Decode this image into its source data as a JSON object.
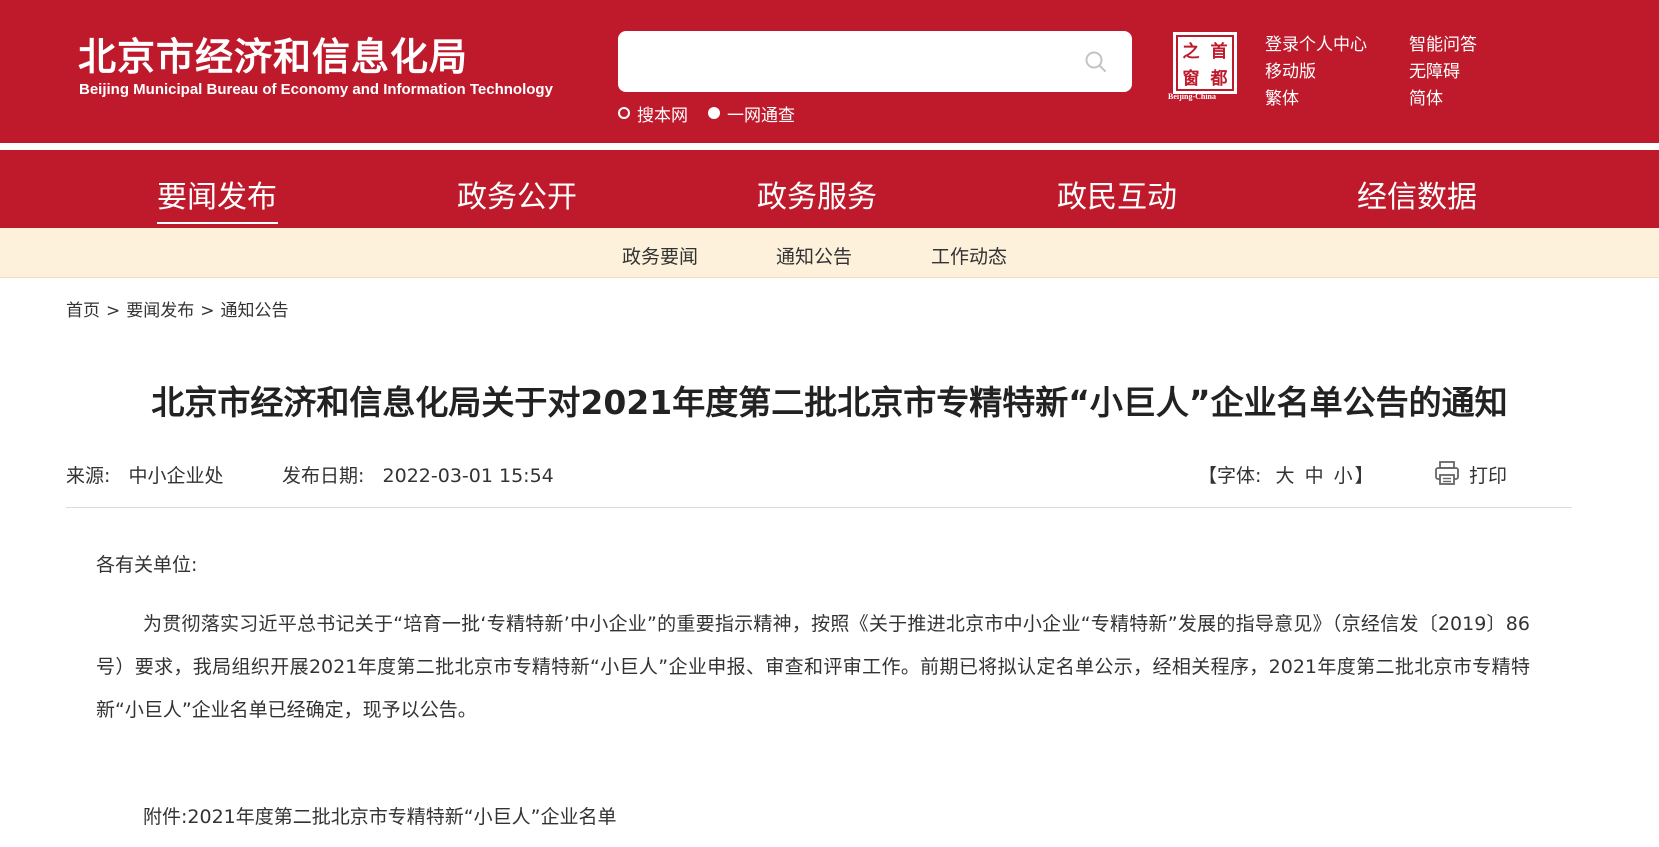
{
  "header": {
    "logo_cn": "北京市经济和信息化局",
    "logo_en": "Beijing Municipal Bureau of Economy and Information Technology",
    "search": {
      "value": "",
      "placeholder": ""
    },
    "search_options": [
      {
        "label": "搜本网",
        "selected": false
      },
      {
        "label": "一网通查",
        "selected": true
      }
    ],
    "seal": {
      "chars": [
        "首",
        "都",
        "之",
        "窗"
      ],
      "caption": "Beijing-China"
    },
    "links": [
      "登录个人中心",
      "智能问答",
      "移动版",
      "无障碍",
      "繁体",
      "简体"
    ]
  },
  "nav": {
    "items": [
      "要闻发布",
      "政务公开",
      "政务服务",
      "政民互动",
      "经信数据"
    ],
    "active_index": 0
  },
  "subnav": {
    "items": [
      "政务要闻",
      "通知公告",
      "工作动态"
    ]
  },
  "breadcrumb": {
    "items": [
      "首页",
      "要闻发布",
      "通知公告"
    ],
    "separator": ">"
  },
  "article": {
    "title": "北京市经济和信息化局关于对2021年度第二批北京市专精特新“小巨人”企业名单公告的通知",
    "source_label": "来源:",
    "source": "中小企业处",
    "date_label": "发布日期:",
    "date": "2022-03-01 15:54",
    "font_label_open": "【字体:",
    "font_sizes": [
      "大",
      "中",
      "小"
    ],
    "font_label_close": "】",
    "print_label": "打印",
    "salutation": "各有关单位:",
    "paragraph": "为贯彻落实习近平总书记关于“培育一批‘专精特新’中小企业”的重要指示精神，按照《关于推进北京市中小企业“专精特新”发展的指导意见》（京经信发〔2019〕86号）要求，我局组织开展2021年度第二批北京市专精特新“小巨人”企业申报、审查和评审工作。前期已将拟认定名单公示，经相关程序，2021年度第二批北京市专精特新“小巨人”企业名单已经确定，现予以公告。",
    "attachment_label": "附件:",
    "attachment": "2021年度第二批北京市专精特新“小巨人”企业名单"
  },
  "colors": {
    "brand_red": "#be1a2c",
    "subnav_bg": "#fdf1dc",
    "text": "#333333"
  }
}
